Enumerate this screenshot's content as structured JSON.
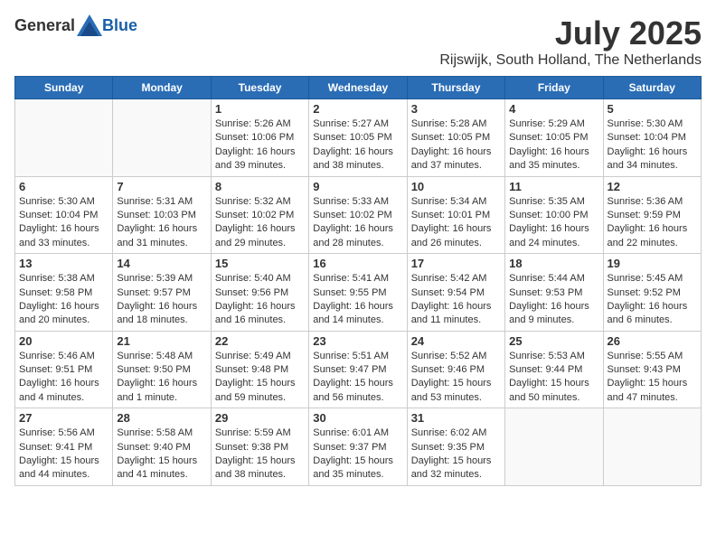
{
  "header": {
    "logo_general": "General",
    "logo_blue": "Blue",
    "month_title": "July 2025",
    "location": "Rijswijk, South Holland, The Netherlands"
  },
  "days_of_week": [
    "Sunday",
    "Monday",
    "Tuesday",
    "Wednesday",
    "Thursday",
    "Friday",
    "Saturday"
  ],
  "weeks": [
    [
      {
        "day": "",
        "info": ""
      },
      {
        "day": "",
        "info": ""
      },
      {
        "day": "1",
        "info": "Sunrise: 5:26 AM\nSunset: 10:06 PM\nDaylight: 16 hours\nand 39 minutes."
      },
      {
        "day": "2",
        "info": "Sunrise: 5:27 AM\nSunset: 10:05 PM\nDaylight: 16 hours\nand 38 minutes."
      },
      {
        "day": "3",
        "info": "Sunrise: 5:28 AM\nSunset: 10:05 PM\nDaylight: 16 hours\nand 37 minutes."
      },
      {
        "day": "4",
        "info": "Sunrise: 5:29 AM\nSunset: 10:05 PM\nDaylight: 16 hours\nand 35 minutes."
      },
      {
        "day": "5",
        "info": "Sunrise: 5:30 AM\nSunset: 10:04 PM\nDaylight: 16 hours\nand 34 minutes."
      }
    ],
    [
      {
        "day": "6",
        "info": "Sunrise: 5:30 AM\nSunset: 10:04 PM\nDaylight: 16 hours\nand 33 minutes."
      },
      {
        "day": "7",
        "info": "Sunrise: 5:31 AM\nSunset: 10:03 PM\nDaylight: 16 hours\nand 31 minutes."
      },
      {
        "day": "8",
        "info": "Sunrise: 5:32 AM\nSunset: 10:02 PM\nDaylight: 16 hours\nand 29 minutes."
      },
      {
        "day": "9",
        "info": "Sunrise: 5:33 AM\nSunset: 10:02 PM\nDaylight: 16 hours\nand 28 minutes."
      },
      {
        "day": "10",
        "info": "Sunrise: 5:34 AM\nSunset: 10:01 PM\nDaylight: 16 hours\nand 26 minutes."
      },
      {
        "day": "11",
        "info": "Sunrise: 5:35 AM\nSunset: 10:00 PM\nDaylight: 16 hours\nand 24 minutes."
      },
      {
        "day": "12",
        "info": "Sunrise: 5:36 AM\nSunset: 9:59 PM\nDaylight: 16 hours\nand 22 minutes."
      }
    ],
    [
      {
        "day": "13",
        "info": "Sunrise: 5:38 AM\nSunset: 9:58 PM\nDaylight: 16 hours\nand 20 minutes."
      },
      {
        "day": "14",
        "info": "Sunrise: 5:39 AM\nSunset: 9:57 PM\nDaylight: 16 hours\nand 18 minutes."
      },
      {
        "day": "15",
        "info": "Sunrise: 5:40 AM\nSunset: 9:56 PM\nDaylight: 16 hours\nand 16 minutes."
      },
      {
        "day": "16",
        "info": "Sunrise: 5:41 AM\nSunset: 9:55 PM\nDaylight: 16 hours\nand 14 minutes."
      },
      {
        "day": "17",
        "info": "Sunrise: 5:42 AM\nSunset: 9:54 PM\nDaylight: 16 hours\nand 11 minutes."
      },
      {
        "day": "18",
        "info": "Sunrise: 5:44 AM\nSunset: 9:53 PM\nDaylight: 16 hours\nand 9 minutes."
      },
      {
        "day": "19",
        "info": "Sunrise: 5:45 AM\nSunset: 9:52 PM\nDaylight: 16 hours\nand 6 minutes."
      }
    ],
    [
      {
        "day": "20",
        "info": "Sunrise: 5:46 AM\nSunset: 9:51 PM\nDaylight: 16 hours\nand 4 minutes."
      },
      {
        "day": "21",
        "info": "Sunrise: 5:48 AM\nSunset: 9:50 PM\nDaylight: 16 hours\nand 1 minute."
      },
      {
        "day": "22",
        "info": "Sunrise: 5:49 AM\nSunset: 9:48 PM\nDaylight: 15 hours\nand 59 minutes."
      },
      {
        "day": "23",
        "info": "Sunrise: 5:51 AM\nSunset: 9:47 PM\nDaylight: 15 hours\nand 56 minutes."
      },
      {
        "day": "24",
        "info": "Sunrise: 5:52 AM\nSunset: 9:46 PM\nDaylight: 15 hours\nand 53 minutes."
      },
      {
        "day": "25",
        "info": "Sunrise: 5:53 AM\nSunset: 9:44 PM\nDaylight: 15 hours\nand 50 minutes."
      },
      {
        "day": "26",
        "info": "Sunrise: 5:55 AM\nSunset: 9:43 PM\nDaylight: 15 hours\nand 47 minutes."
      }
    ],
    [
      {
        "day": "27",
        "info": "Sunrise: 5:56 AM\nSunset: 9:41 PM\nDaylight: 15 hours\nand 44 minutes."
      },
      {
        "day": "28",
        "info": "Sunrise: 5:58 AM\nSunset: 9:40 PM\nDaylight: 15 hours\nand 41 minutes."
      },
      {
        "day": "29",
        "info": "Sunrise: 5:59 AM\nSunset: 9:38 PM\nDaylight: 15 hours\nand 38 minutes."
      },
      {
        "day": "30",
        "info": "Sunrise: 6:01 AM\nSunset: 9:37 PM\nDaylight: 15 hours\nand 35 minutes."
      },
      {
        "day": "31",
        "info": "Sunrise: 6:02 AM\nSunset: 9:35 PM\nDaylight: 15 hours\nand 32 minutes."
      },
      {
        "day": "",
        "info": ""
      },
      {
        "day": "",
        "info": ""
      }
    ]
  ]
}
